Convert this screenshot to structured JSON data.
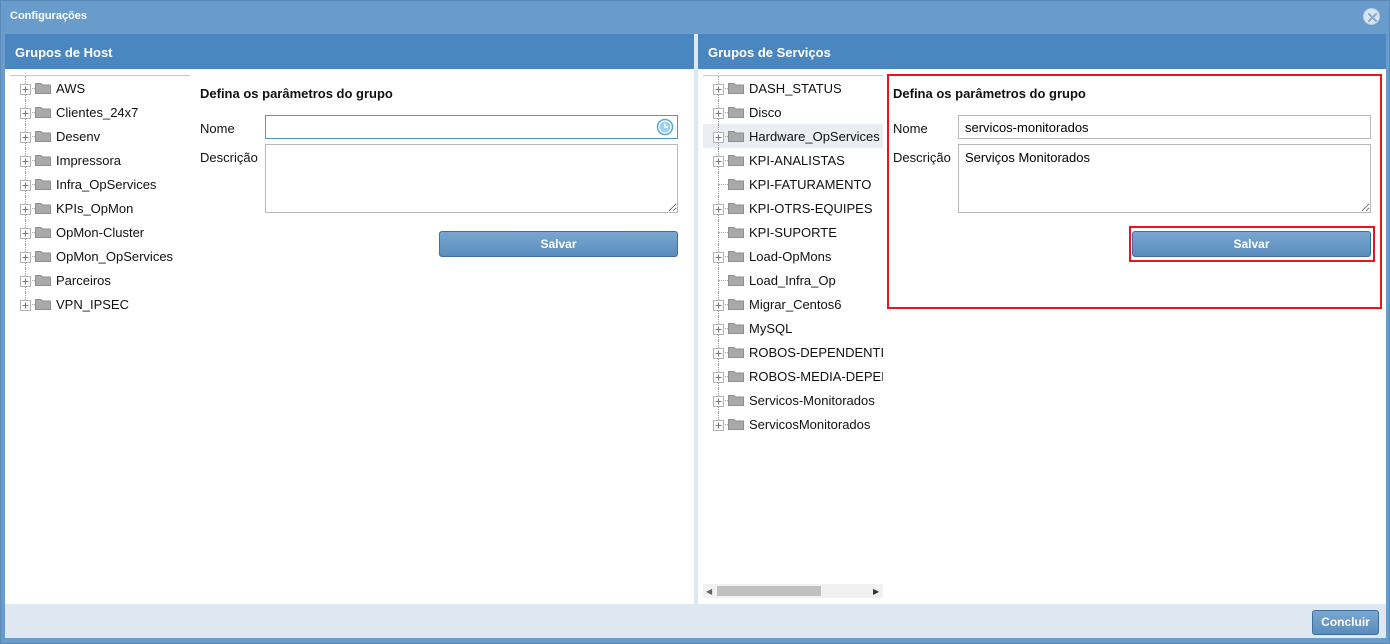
{
  "window": {
    "title": "Configurações",
    "close_icon": "close-icon"
  },
  "host_groups": {
    "header": "Grupos de Host",
    "tree": [
      {
        "label": "AWS"
      },
      {
        "label": "Clientes_24x7"
      },
      {
        "label": "Desenv"
      },
      {
        "label": "Impressora"
      },
      {
        "label": "Infra_OpServices"
      },
      {
        "label": "KPIs_OpMon"
      },
      {
        "label": "OpMon-Cluster"
      },
      {
        "label": "OpMon_OpServices"
      },
      {
        "label": "Parceiros"
      },
      {
        "label": "VPN_IPSEC"
      }
    ],
    "form": {
      "title": "Defina os parâmetros do grupo",
      "name_label": "Nome",
      "name_value": "",
      "description_label": "Descrição",
      "description_value": "",
      "save_label": "Salvar"
    }
  },
  "service_groups": {
    "header": "Grupos de Serviços",
    "tree": [
      {
        "label": "DASH_STATUS",
        "expandable": true
      },
      {
        "label": "Disco",
        "expandable": true
      },
      {
        "label": "Hardware_OpServices",
        "expandable": true,
        "selected": true
      },
      {
        "label": "KPI-ANALISTAS",
        "expandable": true
      },
      {
        "label": "KPI-FATURAMENTO",
        "expandable": false
      },
      {
        "label": "KPI-OTRS-EQUIPES",
        "expandable": true
      },
      {
        "label": "KPI-SUPORTE",
        "expandable": false
      },
      {
        "label": "Load-OpMons",
        "expandable": true
      },
      {
        "label": "Load_Infra_Op",
        "expandable": false
      },
      {
        "label": "Migrar_Centos6",
        "expandable": true
      },
      {
        "label": "MySQL",
        "expandable": true
      },
      {
        "label": "ROBOS-DEPENDENTI",
        "expandable": true
      },
      {
        "label": "ROBOS-MEDIA-DEPEI",
        "expandable": true
      },
      {
        "label": "Servicos-Monitorados",
        "expandable": true
      },
      {
        "label": "ServicosMonitorados",
        "expandable": true
      }
    ],
    "form": {
      "title": "Defina os parâmetros do grupo",
      "name_label": "Nome",
      "name_value": "servicos-monitorados",
      "description_label": "Descrição",
      "description_value": "Serviços Monitorados",
      "save_label": "Salvar"
    }
  },
  "footer": {
    "confirm_label": "Concluir"
  },
  "colors": {
    "header_blue": "#4a87c0",
    "highlight_red": "#e8141e",
    "button_blue": "#5a8cbc"
  }
}
